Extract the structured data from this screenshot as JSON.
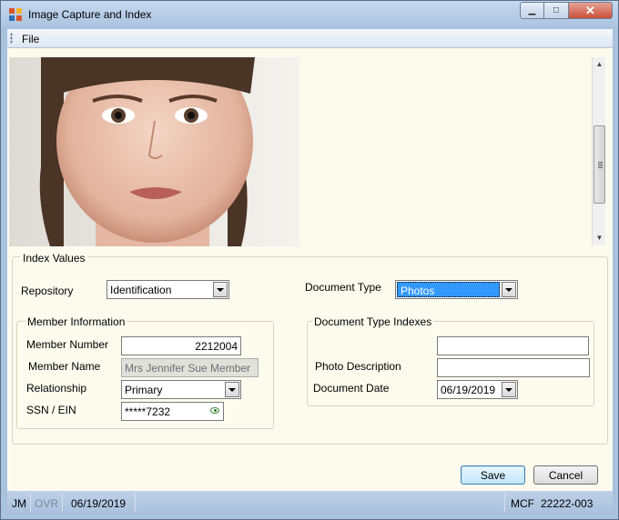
{
  "window": {
    "title": "Image Capture and Index",
    "controls": {
      "minimize": "▁",
      "maximize": "□",
      "close": "✕"
    }
  },
  "menu": {
    "items": [
      {
        "label": "File"
      }
    ]
  },
  "image": {
    "icon": "person-photo"
  },
  "index_values": {
    "legend": "Index Values",
    "repository": {
      "label": "Repository",
      "value": "Identification"
    },
    "document_type": {
      "label": "Document Type",
      "value": "Photos"
    },
    "member_information": {
      "legend": "Member Information",
      "member_number": {
        "label": "Member Number",
        "value": "2212004"
      },
      "member_name": {
        "label": "Member Name",
        "value": "Mrs Jennifer Sue Member"
      },
      "relationship": {
        "label": "Relationship",
        "value": "Primary"
      },
      "ssn_ein": {
        "label": "SSN / EIN",
        "value": "*****7232"
      }
    },
    "document_type_indexes": {
      "legend": "Document Type Indexes",
      "blank_field": {
        "value": ""
      },
      "photo_description": {
        "label": "Photo Description",
        "value": ""
      },
      "document_date": {
        "label": "Document Date",
        "value": "06/19/2019"
      }
    }
  },
  "buttons": {
    "save": "Save",
    "cancel": "Cancel"
  },
  "status": {
    "user": "JM",
    "ovr": "OVR",
    "date": "06/19/2019",
    "mcf": "MCF",
    "account": "22222-003"
  },
  "colors": {
    "selection": "#3399ff",
    "client_bg": "#fdfbee",
    "frame": "#a9c2de"
  }
}
